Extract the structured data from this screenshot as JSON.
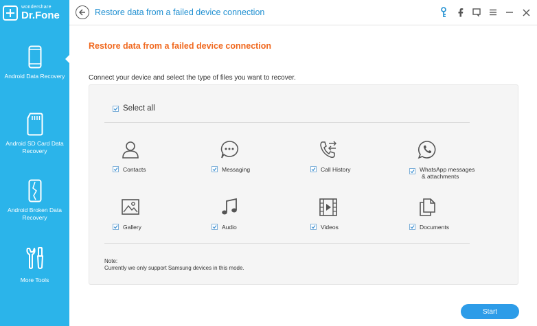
{
  "app": {
    "logo_small": "wondershare",
    "logo_big": "Dr.Fone"
  },
  "sidebar": {
    "items": [
      {
        "label": "Android Data Recovery",
        "icon": "phone-icon",
        "active": true
      },
      {
        "label": "Android SD Card Data Recovery",
        "icon": "sd-card-icon",
        "active": false
      },
      {
        "label": "Android Broken Data Recovery",
        "icon": "broken-phone-icon",
        "active": false
      },
      {
        "label": "More Tools",
        "icon": "tools-icon",
        "active": false
      }
    ]
  },
  "header": {
    "title": "Restore data from a failed device connection",
    "icons": [
      "key-icon",
      "facebook-icon",
      "chat-icon",
      "menu-icon",
      "minimize-icon",
      "close-icon"
    ]
  },
  "main": {
    "page_title": "Restore data from a failed device connection",
    "instruction": "Connect your device and select the type of files you want to recover.",
    "select_all": "Select all",
    "types": [
      {
        "label": "Contacts",
        "icon": "contacts-icon"
      },
      {
        "label": "Messaging",
        "icon": "messaging-icon"
      },
      {
        "label": "Call History",
        "icon": "call-history-icon"
      },
      {
        "label": "WhatsApp messages",
        "label2": "& attachments",
        "icon": "whatsapp-icon"
      },
      {
        "label": "Gallery",
        "icon": "gallery-icon"
      },
      {
        "label": "Audio",
        "icon": "audio-icon"
      },
      {
        "label": "Videos",
        "icon": "videos-icon"
      },
      {
        "label": "Documents",
        "icon": "documents-icon"
      }
    ],
    "note_title": "Note:",
    "note_text": "Currently we only support Samsung devices in this mode.",
    "start_label": "Start"
  },
  "colors": {
    "sidebar": "#2bb4ea",
    "accent_title": "#f0681e",
    "header_title": "#1f8fd1",
    "start_button": "#2d9ce8"
  }
}
